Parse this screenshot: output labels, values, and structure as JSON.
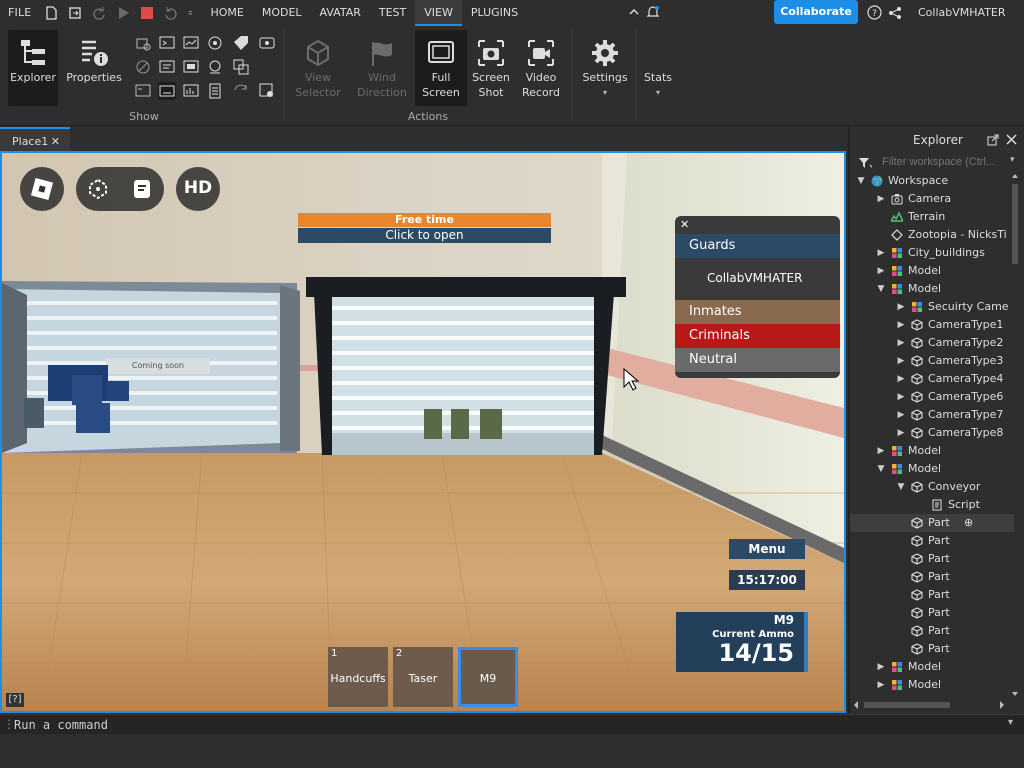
{
  "menubar": {
    "file": "FILE",
    "tabs": [
      "HOME",
      "MODEL",
      "AVATAR",
      "TEST",
      "VIEW",
      "PLUGINS"
    ],
    "active_tab": "VIEW",
    "collaborate": "Collaborate",
    "username": "CollabVMHATER"
  },
  "ribbon": {
    "explorer": "Explorer",
    "properties": "Properties",
    "show_group": "Show",
    "view_selector": [
      "View",
      "Selector"
    ],
    "wind_direction": [
      "Wind",
      "Direction"
    ],
    "full_screen": [
      "Full",
      "Screen"
    ],
    "screen_shot": [
      "Screen",
      "Shot"
    ],
    "video_record": [
      "Video",
      "Record"
    ],
    "actions_group": "Actions",
    "settings": "Settings",
    "stats": "Stats"
  },
  "doc_tab": {
    "label": "Place1",
    "close": "✕"
  },
  "game": {
    "free_time": "Free time",
    "click_to_open": "Click to open",
    "hd": "HD",
    "coming_soon": "Coming soon",
    "team_close": "✕",
    "teams": {
      "guards": "Guards",
      "player": "CollabVMHATER",
      "inmates": "Inmates",
      "criminals": "Criminals",
      "neutral": "Neutral"
    },
    "menu": "Menu",
    "clock": "15:17:00",
    "weapon": "M9",
    "ammo_label": "Current Ammo",
    "ammo": "14/15",
    "hotbar": [
      {
        "num": "1",
        "label": "Handcuffs"
      },
      {
        "num": "2",
        "label": "Taser"
      },
      {
        "num": "",
        "label": "M9"
      }
    ],
    "help": "[?]"
  },
  "explorer": {
    "title": "Explorer",
    "filter_placeholder": "Filter workspace (Ctrl...",
    "tree": [
      {
        "label": "Workspace",
        "depth": 0,
        "arrow": "open",
        "icon": "globe"
      },
      {
        "label": "Camera",
        "depth": 1,
        "arrow": "closed",
        "icon": "camera"
      },
      {
        "label": "Terrain",
        "depth": 1,
        "arrow": "",
        "icon": "terrain"
      },
      {
        "label": "Zootopia - NicksTi",
        "depth": 1,
        "arrow": "",
        "icon": "diamond"
      },
      {
        "label": "City_buildings",
        "depth": 1,
        "arrow": "closed",
        "icon": "model"
      },
      {
        "label": "Model",
        "depth": 1,
        "arrow": "closed",
        "icon": "model"
      },
      {
        "label": "Model",
        "depth": 1,
        "arrow": "open",
        "icon": "model"
      },
      {
        "label": "Secuirty Came",
        "depth": 2,
        "arrow": "closed",
        "icon": "model"
      },
      {
        "label": "CameraType1",
        "depth": 2,
        "arrow": "closed",
        "icon": "part"
      },
      {
        "label": "CameraType2",
        "depth": 2,
        "arrow": "closed",
        "icon": "part"
      },
      {
        "label": "CameraType3",
        "depth": 2,
        "arrow": "closed",
        "icon": "part"
      },
      {
        "label": "CameraType4",
        "depth": 2,
        "arrow": "closed",
        "icon": "part"
      },
      {
        "label": "CameraType6",
        "depth": 2,
        "arrow": "closed",
        "icon": "part"
      },
      {
        "label": "CameraType7",
        "depth": 2,
        "arrow": "closed",
        "icon": "part"
      },
      {
        "label": "CameraType8",
        "depth": 2,
        "arrow": "closed",
        "icon": "part"
      },
      {
        "label": "Model",
        "depth": 1,
        "arrow": "closed",
        "icon": "model"
      },
      {
        "label": "Model",
        "depth": 1,
        "arrow": "open",
        "icon": "model"
      },
      {
        "label": "Conveyor",
        "depth": 2,
        "arrow": "open",
        "icon": "part"
      },
      {
        "label": "Script",
        "depth": 3,
        "arrow": "",
        "icon": "script"
      },
      {
        "label": "Part",
        "depth": 2,
        "arrow": "",
        "icon": "part",
        "selected": true
      },
      {
        "label": "Part",
        "depth": 2,
        "arrow": "",
        "icon": "part"
      },
      {
        "label": "Part",
        "depth": 2,
        "arrow": "",
        "icon": "part"
      },
      {
        "label": "Part",
        "depth": 2,
        "arrow": "",
        "icon": "part"
      },
      {
        "label": "Part",
        "depth": 2,
        "arrow": "",
        "icon": "part"
      },
      {
        "label": "Part",
        "depth": 2,
        "arrow": "",
        "icon": "part"
      },
      {
        "label": "Part",
        "depth": 2,
        "arrow": "",
        "icon": "part"
      },
      {
        "label": "Part",
        "depth": 2,
        "arrow": "",
        "icon": "part"
      },
      {
        "label": "Model",
        "depth": 1,
        "arrow": "closed",
        "icon": "model"
      },
      {
        "label": "Model",
        "depth": 1,
        "arrow": "closed",
        "icon": "model"
      }
    ]
  },
  "command_bar": {
    "placeholder": "Run a command"
  },
  "colors": {
    "accent": "#1d8fe6",
    "guards": "#2c4a66",
    "inmates": "#8a6a4e",
    "criminals": "#b81818",
    "neutral": "#6a6a6a",
    "free_time": "#e8862b"
  }
}
